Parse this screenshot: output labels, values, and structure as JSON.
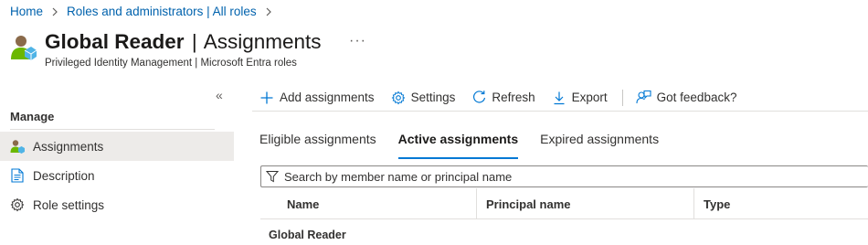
{
  "breadcrumb": {
    "items": [
      "Home",
      "Roles and administrators | All roles"
    ]
  },
  "header": {
    "title_bold": "Global Reader",
    "title_sep": "|",
    "title_rest": "Assignments",
    "subtitle": "Privileged Identity Management | Microsoft Entra roles",
    "more": "···"
  },
  "sidebar": {
    "collapse": "«",
    "section": "Manage",
    "items": [
      {
        "label": "Assignments",
        "icon": "user-assign-icon",
        "active": true
      },
      {
        "label": "Description",
        "icon": "document-icon"
      },
      {
        "label": "Role settings",
        "icon": "gear-icon"
      }
    ]
  },
  "toolbar": {
    "add": "Add assignments",
    "settings": "Settings",
    "refresh": "Refresh",
    "export": "Export",
    "feedback": "Got feedback?"
  },
  "tabs": [
    "Eligible assignments",
    "Active assignments",
    "Expired assignments"
  ],
  "search": {
    "placeholder": "Search by member name or principal name"
  },
  "table": {
    "columns": [
      "Name",
      "Principal name",
      "Type"
    ],
    "group_row": "Global Reader"
  },
  "colors": {
    "accent": "#0078d4",
    "link": "#0062ad",
    "active_bg": "#edebe9"
  }
}
